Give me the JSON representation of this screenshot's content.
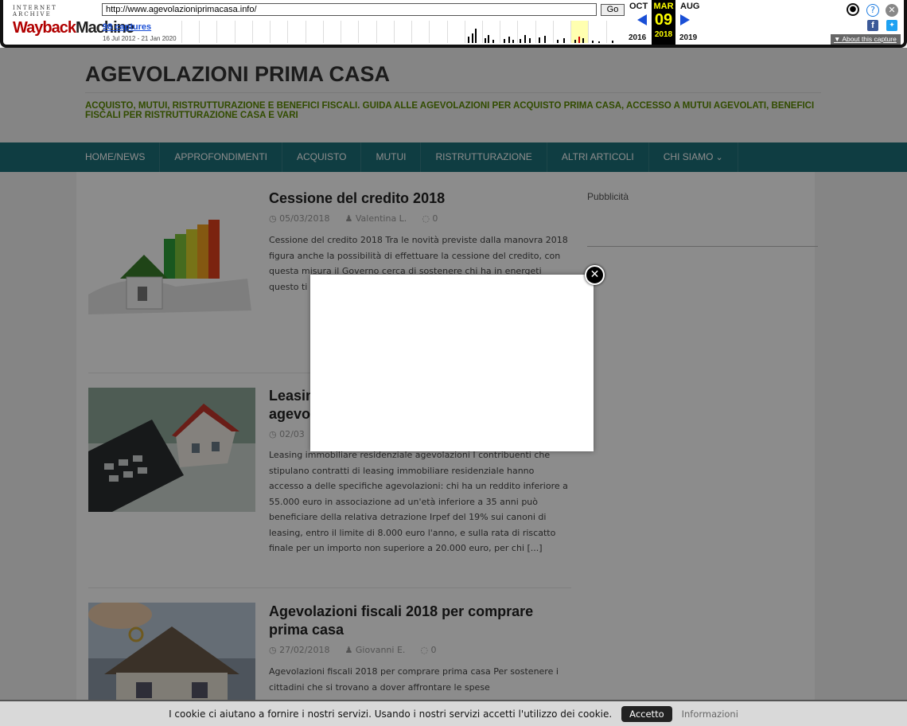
{
  "wayback": {
    "logo_top": "INTERNET ARCHIVE",
    "logo_a": "Wayback",
    "logo_b": "Machine",
    "url": "http://www.agevolazioniprimacasa.info/",
    "go_label": "Go",
    "captures": "98 captures",
    "range": "16 Jul 2012 - 21 Jan 2020",
    "prev_month": "OCT",
    "cur_month": "MAR",
    "next_month": "AUG",
    "cur_day": "09",
    "prev_year": "2016",
    "cur_year": "2018",
    "next_year": "2019",
    "about": "About this capture"
  },
  "site": {
    "title": "AGEVOLAZIONI PRIMA CASA",
    "tagline": "ACQUISTO, MUTUI, RISTRUTTURAZIONE E BENEFICI FISCALI. GUIDA ALLE AGEVOLAZIONI PER ACQUISTO PRIMA CASA, ACCESSO A MUTUI AGEVOLATI, BENEFICI FISCALI PER RISTRUTTURAZIONE CASA E VARI",
    "accent": "#1d6f78"
  },
  "nav": {
    "items": [
      "HOME/NEWS",
      "APPROFONDIMENTI",
      "ACQUISTO",
      "MUTUI",
      "RISTRUTTURAZIONE",
      "ALTRI ARTICOLI",
      "CHI SIAMO"
    ]
  },
  "posts": [
    {
      "title": "Cessione del credito 2018",
      "date": "05/03/2018",
      "author": "Valentina L.",
      "comments": "0",
      "excerpt": "Cessione del credito 2018 Tra le novità previste dalla manovra 2018 figura anche la possibilità di effettuare la cessione del credito, con questa misura il Governo cerca di sostenere chi ha in energeti questo ti recupero attraver"
    },
    {
      "title": "Leasin agevo",
      "date": "02/03",
      "author": "",
      "comments": "",
      "excerpt": "Leasing immobiliare residenziale agevolazioni I contribuenti che stipulano contratti di leasing immobiliare residenziale hanno accesso a delle specifiche agevolazioni: chi ha un reddito inferiore a 55.000 euro in associazione ad un'età inferiore a 35 anni può beneficiare della relativa detrazione Irpef del 19% sui canoni di leasing, entro il limite di 8.000 euro l'anno, e sulla rata di riscatto finale per un importo non superiore a 20.000 euro, per chi [...]"
    },
    {
      "title": "Agevolazioni fiscali 2018 per comprare prima casa",
      "date": "27/02/2018",
      "author": "Giovanni E.",
      "comments": "0",
      "excerpt": "Agevolazioni fiscali 2018 per comprare prima casa Per sostenere i cittadini che si trovano a dover affrontare le spese"
    }
  ],
  "sidebar": {
    "title": "Pubblicità"
  },
  "cookie": {
    "text": "I cookie ci aiutano a fornire i nostri servizi. Usando i nostri servizi accetti l'utilizzo dei cookie.",
    "accept": "Accetto",
    "info": "Informazioni"
  },
  "icons": {
    "close": "close-icon",
    "clock": "clock-icon",
    "user": "user-icon",
    "comment": "comment-icon"
  }
}
